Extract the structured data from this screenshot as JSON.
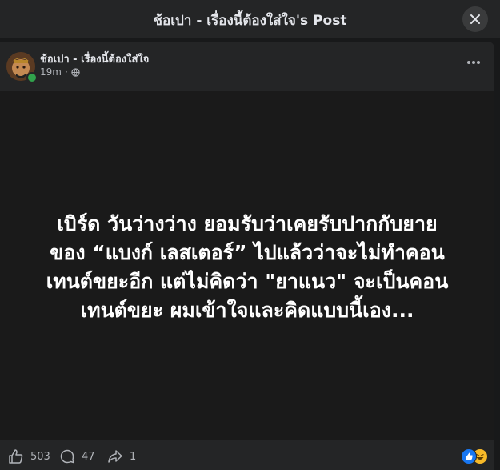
{
  "header": {
    "title": "ช้อเปา - เรื่องนี้ต้องใส่ใจ's Post"
  },
  "post": {
    "page_name": "ช้อเปา - เรื่องนี้ต้องใส่ใจ",
    "time": "19m",
    "separator": "·",
    "privacy_icon": "globe-icon",
    "image_text_lines": [
      "เบิร์ด วันว่างว่าง ยอมรับว่าเคยรับปากกับยาย",
      "ของ “แบงก์ เลสเตอร์” ไปแล้วว่าจะไม่ทำคอน",
      "เทนต์ขยะอีก แต่ไม่คิดว่า \"ยาแนว\" จะเป็นคอน",
      "เทนต์ขยะ ผมเข้าใจและคิดแบบนี้เอง..."
    ]
  },
  "actions": {
    "likes": "503",
    "comments": "47",
    "shares": "1"
  },
  "colors": {
    "background": "#18191a",
    "card": "#242526",
    "online": "#31a24c",
    "like_blue": "#1877f2",
    "haha_yellow": "#f7b928"
  }
}
